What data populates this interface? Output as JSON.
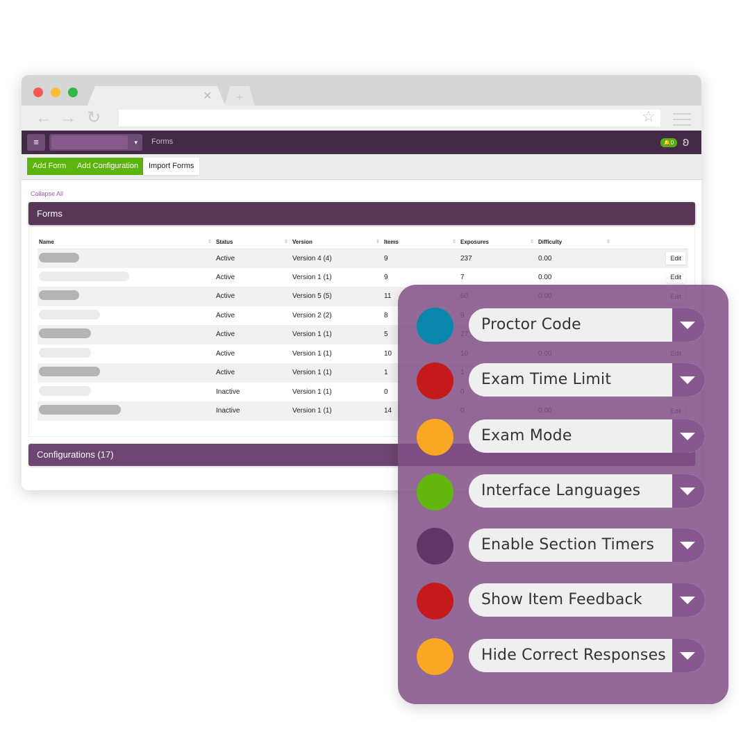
{
  "browser": {
    "tab_close_glyph": "×",
    "new_tab_glyph": "+",
    "back_glyph": "←",
    "forward_glyph": "→",
    "reload_glyph": "↻",
    "bookmark_glyph": "☆"
  },
  "appbar": {
    "menu_glyph": "≡",
    "select_caret": "▾",
    "breadcrumb": "Forms",
    "notifications": "🔔0",
    "logo_glyph": "ʚ"
  },
  "toolbar": {
    "add_form": "Add Form",
    "add_configuration": "Add Configuration",
    "import_forms": "Import Forms"
  },
  "content": {
    "collapse_all": "Collapse All",
    "forms_title": "Forms",
    "configurations_title": "Configurations (17)",
    "columns": [
      "Name",
      "Status",
      "Version",
      "Items",
      "Exposures",
      "Difficulty",
      ""
    ],
    "sort_glyph": "⇳",
    "edit_label": "Edit",
    "rows": [
      {
        "status": "Active",
        "version": "Version 4 (4)",
        "items": "9",
        "exposures": "237",
        "difficulty": "0.00"
      },
      {
        "status": "Active",
        "version": "Version 1 (1)",
        "items": "9",
        "exposures": "7",
        "difficulty": "0.00"
      },
      {
        "status": "Active",
        "version": "Version 5 (5)",
        "items": "11",
        "exposures": "60",
        "difficulty": "0.00"
      },
      {
        "status": "Active",
        "version": "Version 2 (2)",
        "items": "8",
        "exposures": "9",
        "difficulty": ""
      },
      {
        "status": "Active",
        "version": "Version 1 (1)",
        "items": "5",
        "exposures": "27",
        "difficulty": ""
      },
      {
        "status": "Active",
        "version": "Version 1 (1)",
        "items": "10",
        "exposures": "10",
        "difficulty": "0.00"
      },
      {
        "status": "Active",
        "version": "Version 1 (1)",
        "items": "1",
        "exposures": "1",
        "difficulty": ""
      },
      {
        "status": "Inactive",
        "version": "Version 1 (1)",
        "items": "0",
        "exposures": "0",
        "difficulty": ""
      },
      {
        "status": "Inactive",
        "version": "Version 1 (1)",
        "items": "14",
        "exposures": "0",
        "difficulty": "0.00"
      }
    ]
  },
  "options": [
    {
      "label": "Proctor Code",
      "color": "#0986ac"
    },
    {
      "label": "Exam Time Limit",
      "color": "#c41a1c"
    },
    {
      "label": "Exam Mode",
      "color": "#f9a724"
    },
    {
      "label": "Interface Languages",
      "color": "#63b60e"
    },
    {
      "label": "Enable Section Timers",
      "color": "#613568"
    },
    {
      "label": "Show Item Feedback",
      "color": "#c41a1c"
    },
    {
      "label": "Hide Correct Responses",
      "color": "#f9a724"
    }
  ],
  "colors": {
    "appbar": "#432a46",
    "panel_header": "#583656",
    "accent_green": "#5db40f",
    "overlay": "#804f86"
  }
}
